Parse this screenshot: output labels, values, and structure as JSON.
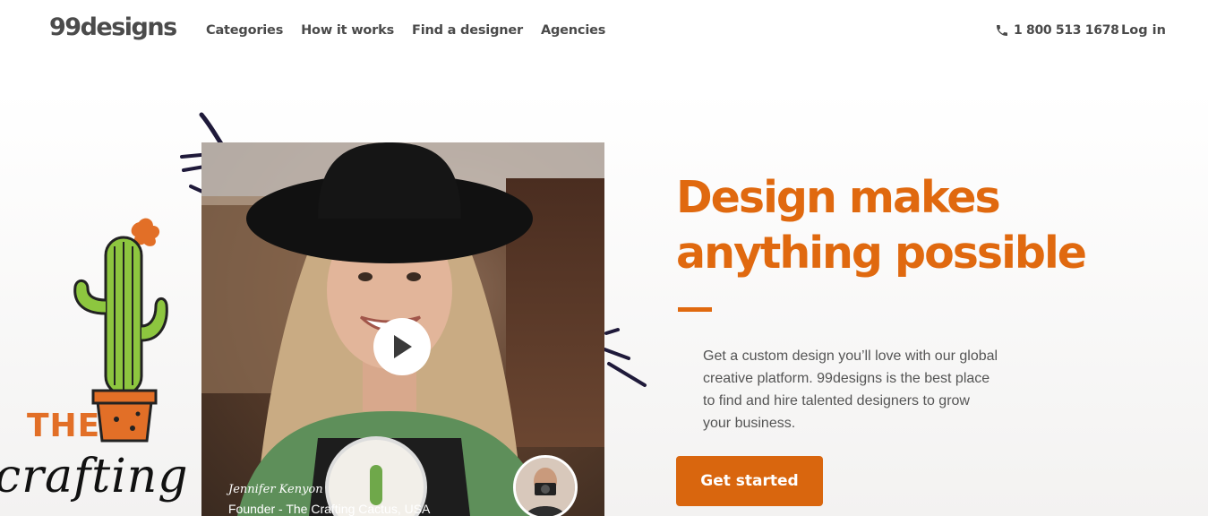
{
  "header": {
    "logo": "99designs",
    "nav": [
      "Categories",
      "How it works",
      "Find a designer",
      "Agencies"
    ],
    "phone": "1 800 513 1678",
    "login": "Log in"
  },
  "illustration": {
    "brand_the": "THE",
    "brand_script": "crafting cactus"
  },
  "video": {
    "name": "Jennifer Kenyon",
    "role": "Founder - The Crafting Cactus, USA",
    "play_icon": "play-icon"
  },
  "hero": {
    "headline_line1": "Design makes",
    "headline_line2": "anything possible",
    "description": "Get a custom design you’ll love with our global creative platform. 99designs is the best place to find and hire talented designers to grow your business.",
    "cta": "Get started"
  },
  "colors": {
    "accent": "#e0690f",
    "button": "#d9660e",
    "text": "#4a4a4a"
  }
}
